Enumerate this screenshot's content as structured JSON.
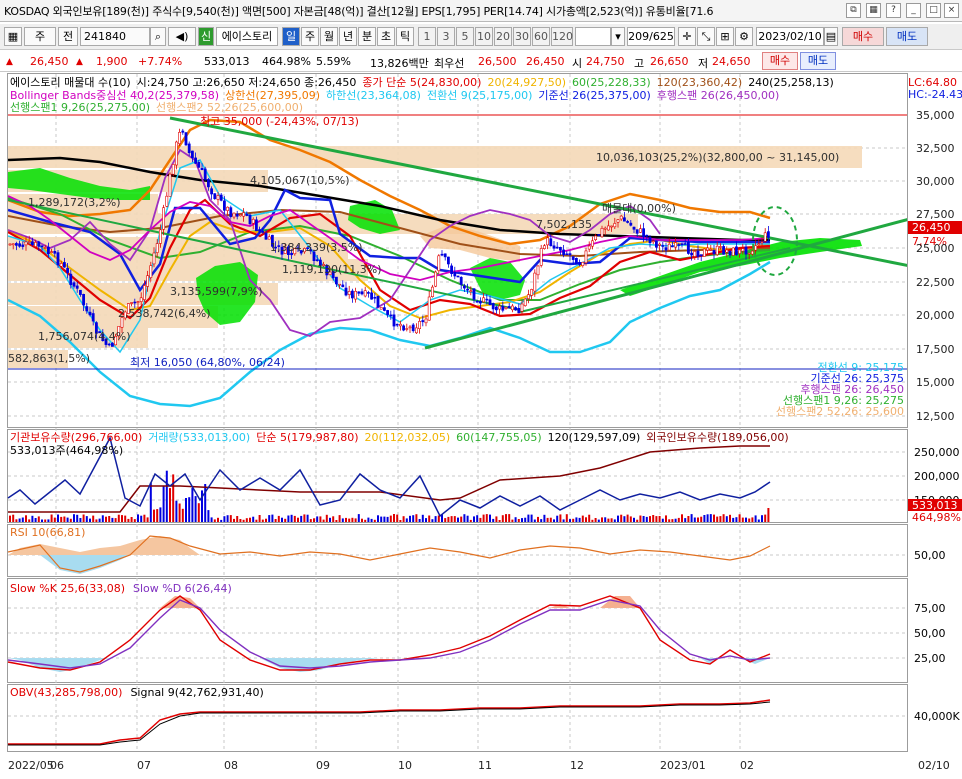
{
  "window": {
    "title": "KOSDAQ 외국인보유[189(천)] 주식수[9,540(천)] 액면[500] 자본금[48(억)] 결산[12월] EPS[1,795] PER[14.74] 시가총액[2,523(억)] 유통비율[71.6"
  },
  "toolbar": {
    "period_mode": "주",
    "prev_label": "전",
    "code": "241840",
    "badge": "신",
    "stock_name": "에이스토리",
    "periods": [
      "일",
      "주",
      "월",
      "년",
      "분",
      "초",
      "틱"
    ],
    "active_period": "일",
    "intervals": [
      "1",
      "3",
      "5",
      "10",
      "20",
      "30",
      "60",
      "120"
    ],
    "page_count": "209/625",
    "date": "2023/02/10",
    "buy": "매수",
    "sell": "매도"
  },
  "quote": {
    "price": "26,450",
    "change": "1,900",
    "change_pct": "+7.74%",
    "volume": "533,013",
    "volume_ratio": "464.98%",
    "pct": "5.59%",
    "amount": "13,826백만",
    "best_label": "최우선",
    "best": "26,500",
    "best2": "26,450",
    "open_label": "시",
    "open": "24,750",
    "high_label": "고",
    "high": "26,650",
    "low_label": "저",
    "low": "24,650"
  },
  "colors": {
    "up": "#e00000",
    "down": "#0000e0",
    "ma5": "#e00000",
    "ma20": "#f0b400",
    "ma60": "#30b030",
    "ma120": "#a05018",
    "ma240": "#000000",
    "bb_upper": "#f07800",
    "bb_lower": "#20c8f0",
    "bb_mid": "#d000c0",
    "conversion": "#1020e0",
    "base": "#1020e0",
    "lagging": "#a030c0",
    "cloud_green": "#00e000",
    "cloud_peach": "#f5d9b8",
    "trend": "#20a840",
    "grid": "#bcbcbc"
  },
  "main_panel": {
    "legend1": [
      {
        "text": "에이스토리 매물대 수(10)",
        "color": "#000000"
      },
      {
        "text": "시:24,750 고:26,650 저:24,650 종:26,450",
        "color": "#000000"
      },
      {
        "text": "종가 단순 5(24,830,00)",
        "color": "#e00000"
      },
      {
        "text": "20(24,927,50)",
        "color": "#f0b400"
      },
      {
        "text": "60(25,228,33)",
        "color": "#30b030"
      },
      {
        "text": "120(23,360,42)",
        "color": "#a05018"
      },
      {
        "text": "240(25,258,13)",
        "color": "#000000"
      }
    ],
    "legend2": [
      {
        "text": "Bollinger Bands중심선 40,2(25,379,58)",
        "color": "#d000c0"
      },
      {
        "text": "상한선(27,395,09)",
        "color": "#f07800"
      },
      {
        "text": "하한선(23,364,08)",
        "color": "#20c8f0"
      },
      {
        "text": "전환선 9(25,175,00)",
        "color": "#20c8f0"
      },
      {
        "text": "기준선 26(25,375,00)",
        "color": "#1020e0"
      },
      {
        "text": "후행스팬 26(26,450,00)",
        "color": "#a030c0"
      }
    ],
    "legend3": [
      {
        "text": "선행스팬1 9,26(25,275,00)",
        "color": "#30b030"
      },
      {
        "text": "선행스팬2 52,26(25,600,00)",
        "color": "#f0b070"
      }
    ],
    "lc": "LC:64.80",
    "hc": "HC:-24.43",
    "max_label": "최고 35,000 (-24,43%, 07/13)",
    "min_label": "최저 16,050 (64,80%, 06/24)",
    "volume_profile": [
      "10,036,103(25,2%)(32,800,00 ~ 31,145,00)",
      "4,105,067(10,5%)",
      "7,502,135",
      "매물대(0,00%)",
      "1,384,339(3,5%)",
      "1,119,130(11,3%)",
      "3,135,599(7,9%)",
      "2,538,742(6,4%)",
      "1,756,074(4,4%)",
      "582,863(1,5%)",
      "1,289,172(3,2%)"
    ],
    "price_tag": "26,450",
    "pct_tag": "7,74%",
    "yaxis": [
      "35,000",
      "32,500",
      "30,000",
      "27,500",
      "25,000",
      "22,500",
      "20,000",
      "17,500",
      "15,000",
      "12,500"
    ],
    "right_legend": [
      {
        "text": "전환선 9: 25,175",
        "color": "#20c8f0"
      },
      {
        "text": "기준선 26: 25,375",
        "color": "#1020e0"
      },
      {
        "text": "후행스팬 26: 26,450",
        "color": "#a030c0"
      },
      {
        "text": "선행스팬1 9,26: 25,275",
        "color": "#30b030"
      },
      {
        "text": "선행스팬2 52,26: 25,600",
        "color": "#f0b070"
      }
    ]
  },
  "volume_panel": {
    "legend": [
      {
        "text": "기관보유수량(296,766,00)",
        "color": "#e00000"
      },
      {
        "text": "거래량(533,013,00)",
        "color": "#20c8f0"
      },
      {
        "text": "단순 5(179,987,80)",
        "color": "#e00000"
      },
      {
        "text": "20(112,032,05)",
        "color": "#f0b400"
      },
      {
        "text": "60(147,755,05)",
        "color": "#30b030"
      },
      {
        "text": "120(129,597,09)",
        "color": "#000000"
      },
      {
        "text": "외국인보유수량(189,056,00)",
        "color": "#800000"
      }
    ],
    "sub": "533,013주(464,98%)",
    "yaxis": [
      "250,000",
      "200,000",
      "150,000"
    ],
    "tag": "533,013",
    "tag2": "464,98%"
  },
  "rsi_panel": {
    "legend": "RSI 10(66,81)",
    "yaxis": [
      "50,00"
    ]
  },
  "stoch_panel": {
    "legend_k": "Slow %K 25,6(33,08)",
    "legend_d": "Slow %D 6(26,44)",
    "yaxis": [
      "75,00",
      "50,00",
      "25,00"
    ]
  },
  "obv_panel": {
    "legend_obv": "OBV(43,285,798,00)",
    "legend_sig": "Signal 9(42,762,931,40)",
    "yaxis": [
      "40,000K"
    ]
  },
  "xaxis": [
    "2022/05",
    "06",
    "07",
    "08",
    "09",
    "10",
    "11",
    "12",
    "2023/01",
    "02",
    "02/10"
  ]
}
